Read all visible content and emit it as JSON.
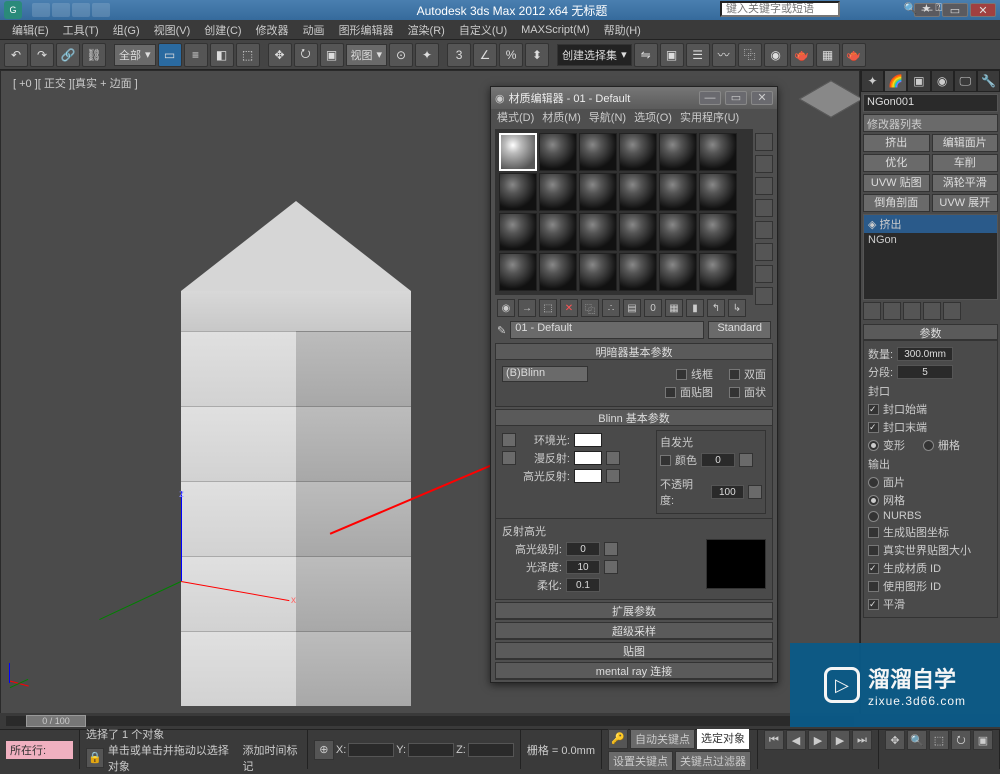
{
  "app": {
    "title": "Autodesk 3ds Max 2012 x64   无标题",
    "search_placeholder": "键入关键字或短语"
  },
  "menu": [
    "编辑(E)",
    "工具(T)",
    "组(G)",
    "视图(V)",
    "创建(C)",
    "修改器",
    "动画",
    "图形编辑器",
    "渲染(R)",
    "自定义(U)",
    "MAXScript(M)",
    "帮助(H)"
  ],
  "toolbar": {
    "selset": "全部",
    "coordsys": "视图",
    "namedset": "创建选择集"
  },
  "viewport": {
    "label": "[ +0 ][ 正交 ][真实 + 边面 ]",
    "axes": {
      "x": "x",
      "y": "y",
      "z": "z"
    }
  },
  "material_editor": {
    "title": "材质编辑器 - 01 - Default",
    "menu": [
      "模式(D)",
      "材质(M)",
      "导航(N)",
      "选项(O)",
      "实用程序(U)"
    ],
    "current_name": "01 - Default",
    "type_btn": "Standard",
    "rollouts": {
      "shader_basic": "明暗器基本参数",
      "shader": "(B)Blinn",
      "wire": "线框",
      "two_sided": "双面",
      "face_map": "面贴图",
      "faceted": "面状",
      "blinn_basic": "Blinn 基本参数",
      "ambient": "环境光:",
      "diffuse": "漫反射:",
      "specular": "高光反射:",
      "self_illum_hdr": "自发光",
      "self_color": "颜色",
      "self_val": "0",
      "opacity": "不透明度:",
      "opacity_val": "100",
      "spec_hdr": "反射高光",
      "spec_level": "高光级别:",
      "spec_level_val": "0",
      "gloss": "光泽度:",
      "gloss_val": "10",
      "soften": "柔化:",
      "soften_val": "0.1",
      "extended": "扩展参数",
      "supersample": "超级采样",
      "maps": "贴图",
      "mentalray": "mental ray 连接"
    }
  },
  "cmd": {
    "object_name": "NGon001",
    "mod_list": "修改器列表",
    "buttons": [
      "挤出",
      "编辑面片",
      "优化",
      "车削",
      "UVW 贴图",
      "涡轮平滑",
      "倒角剖面",
      "UVW 展开"
    ],
    "stack": [
      "挤出",
      "NGon"
    ],
    "params_hdr": "参数",
    "amount": "数量:",
    "amount_val": "300.0mm",
    "segments": "分段:",
    "segments_val": "5",
    "cap_group": "封口",
    "cap_start": "封口始端",
    "cap_end": "封口末端",
    "morph": "变形",
    "grid": "栅格",
    "output_group": "输出",
    "patch": "面片",
    "mesh": "网格",
    "nurbs": "NURBS",
    "gen_uvs": "生成贴图坐标",
    "real_world": "真实世界贴图大小",
    "gen_matids": "生成材质 ID",
    "use_shape_ids": "使用图形 ID",
    "smooth": "平滑"
  },
  "timeline": {
    "pos": "0 / 100"
  },
  "status": {
    "sel": "选择了 1 个对象",
    "hint": "单击或单击并拖动以选择对象",
    "add_time": "添加时间标记",
    "x": "X:",
    "y": "Y:",
    "z": "Z:",
    "grid": "栅格 = 0.0mm",
    "autokey": "自动关键点",
    "selkey": "选定对象",
    "setkey": "设置关键点",
    "keyfilter": "关键点过滤器",
    "command_label": "所在行:"
  },
  "watermark": {
    "name": "溜溜自学",
    "url": "zixue.3d66.com"
  }
}
